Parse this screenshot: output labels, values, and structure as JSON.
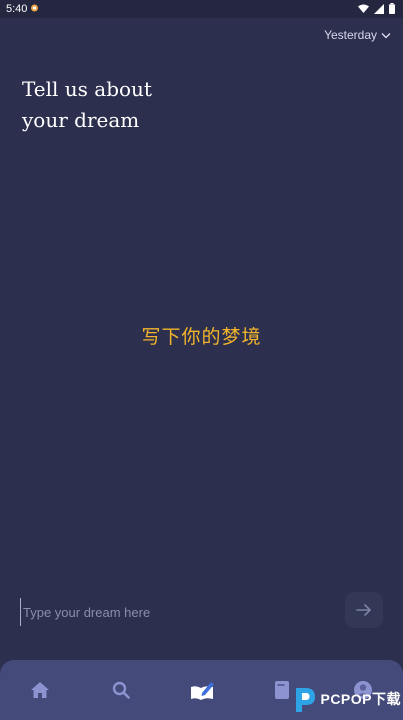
{
  "status_bar": {
    "time": "5:40",
    "icons": [
      "wifi-icon",
      "signal-icon",
      "battery-icon"
    ]
  },
  "date_selector": {
    "label": "Yesterday",
    "icon": "chevron-down-icon"
  },
  "heading": {
    "line1": "Tell us about",
    "line2": "your dream"
  },
  "center_hint": "写下你的梦境",
  "dream_input": {
    "placeholder": "Type your dream here",
    "value": ""
  },
  "send_button": {
    "icon": "arrow-right-icon"
  },
  "bottom_nav": {
    "items": [
      {
        "id": "home",
        "icon": "home-icon",
        "active": false
      },
      {
        "id": "search",
        "icon": "search-icon",
        "active": false
      },
      {
        "id": "write",
        "icon": "write-dream-icon",
        "active": true
      },
      {
        "id": "journal",
        "icon": "journal-icon",
        "active": false
      },
      {
        "id": "profile",
        "icon": "profile-icon",
        "active": false
      }
    ]
  },
  "watermark": {
    "text": "PCPOP下载"
  },
  "colors": {
    "background": "#2c2f4e",
    "nav_background": "#444a7a",
    "hint": "#f3b52b",
    "icon_inactive": "#8c93d0",
    "icon_active_blue": "#3f6fd8"
  }
}
